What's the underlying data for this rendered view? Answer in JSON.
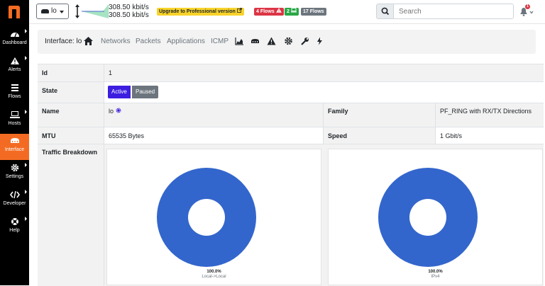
{
  "sidebar": {
    "logo": "n",
    "items": [
      {
        "label": "Dashboard",
        "icon": "gauge-icon"
      },
      {
        "label": "Alerts",
        "icon": "warning-icon"
      },
      {
        "label": "Flows",
        "icon": "list-icon"
      },
      {
        "label": "Hosts",
        "icon": "laptop-icon"
      },
      {
        "label": "Interface",
        "icon": "ethernet-icon"
      },
      {
        "label": "Settings",
        "icon": "gear-icon"
      },
      {
        "label": "Developer",
        "icon": "code-icon"
      },
      {
        "label": "Help",
        "icon": "lifebuoy-icon"
      }
    ],
    "active_index": 4,
    "active_color": "#f36b22"
  },
  "topbar": {
    "interface_value": "lo",
    "rate_up": "308.50 kbit/s",
    "rate_down": "308.50 kbit/s",
    "upgrade_label": "Upgrade to Professional version",
    "flows_alert_label": "4 Flows",
    "hosts_label": "2",
    "total_flows_label": "17 Flows",
    "search_placeholder": "Search",
    "notification_count": "1"
  },
  "subnav": {
    "title": "Interface: lo",
    "links": [
      "Networks",
      "Packets",
      "Applications",
      "ICMP"
    ],
    "icons": [
      "area-chart-icon",
      "hdd-icon",
      "warning-icon",
      "gear-icon",
      "wrench-icon",
      "bolt-icon"
    ]
  },
  "details": {
    "id_label": "Id",
    "id_value": "1",
    "state_label": "State",
    "state_active": "Active",
    "state_paused": "Paused",
    "name_label": "Name",
    "name_value": "lo",
    "family_label": "Family",
    "family_value": "PF_RING with RX/TX Directions",
    "mtu_label": "MTU",
    "mtu_value": "65535 Bytes",
    "speed_label": "Speed",
    "speed_value": "1 Gbit/s",
    "traffic_label": "Traffic Breakdown"
  },
  "chart_data": [
    {
      "type": "pie",
      "categories": [
        "Local->Local"
      ],
      "values": [
        100.0
      ],
      "labels": [
        "100.0%"
      ],
      "colors": [
        "#3366cc"
      ],
      "donut": true
    },
    {
      "type": "pie",
      "categories": [
        "IPv4"
      ],
      "values": [
        100.0
      ],
      "labels": [
        "100.0%"
      ],
      "colors": [
        "#3366cc"
      ],
      "donut": true
    }
  ]
}
